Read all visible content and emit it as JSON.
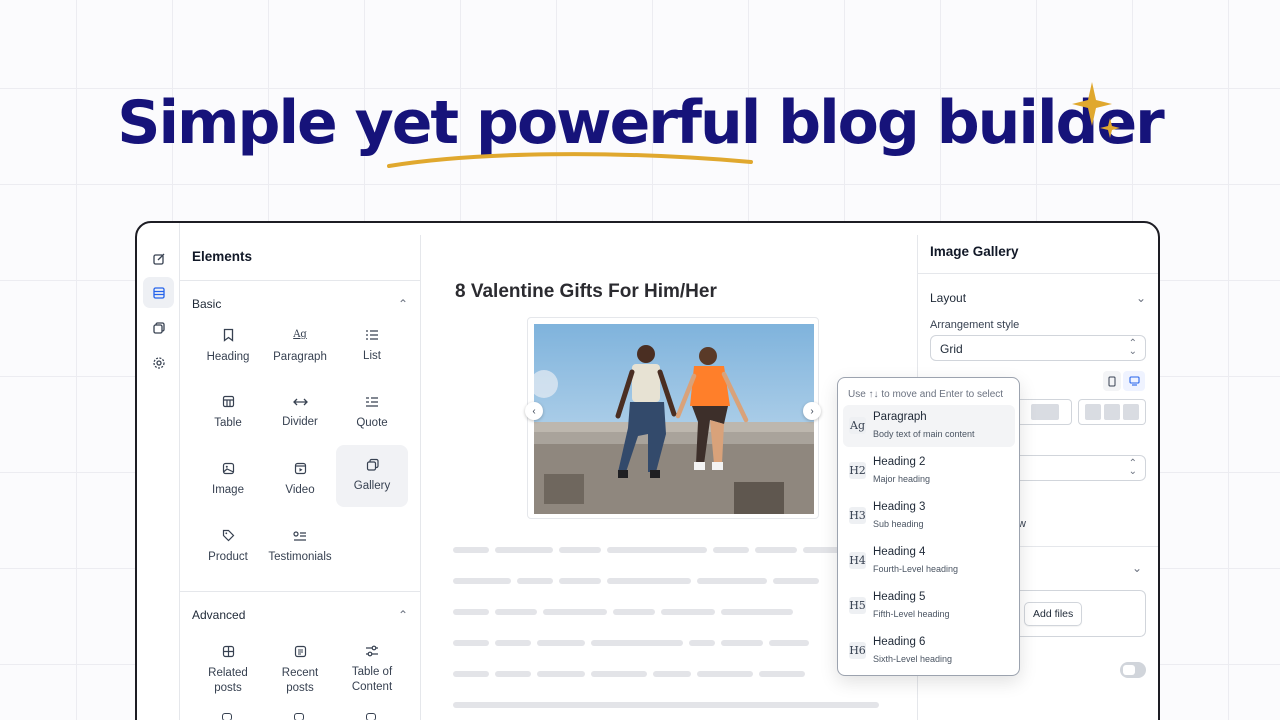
{
  "hero": {
    "title": "Simple yet powerful blog builder"
  },
  "sidebar": {
    "title": "Elements",
    "sections": [
      {
        "label": "Basic",
        "items": [
          "Heading",
          "Paragraph",
          "List",
          "Table",
          "Divider",
          "Quote",
          "Image",
          "Video",
          "Gallery",
          "Product",
          "Testimonials"
        ]
      },
      {
        "label": "Advanced",
        "items": [
          "Related posts",
          "Recent posts",
          "Table of Content"
        ]
      }
    ]
  },
  "canvas": {
    "post_title": "8 Valentine Gifts For Him/Her"
  },
  "panel": {
    "title": "Image Gallery",
    "layout_label": "Layout",
    "arrangement_label": "Arrangement style",
    "arrangement_value": "Grid",
    "partial_w": "w",
    "add_files": "Add files"
  },
  "popup": {
    "hint": "Use ↑↓ to move and Enter to select",
    "options": [
      {
        "icon": "Ag",
        "title": "Paragraph",
        "desc": "Body text of main content"
      },
      {
        "icon": "H2",
        "title": "Heading 2",
        "desc": "Major heading"
      },
      {
        "icon": "H3",
        "title": "Heading 3",
        "desc": "Sub heading"
      },
      {
        "icon": "H4",
        "title": "Heading 4",
        "desc": "Fourth-Level heading"
      },
      {
        "icon": "H5",
        "title": "Heading 5",
        "desc": "Fifth-Level heading"
      },
      {
        "icon": "H6",
        "title": "Heading 6",
        "desc": "Sixth-Level heading"
      }
    ]
  },
  "colors": {
    "brand_navy": "#16137a",
    "accent_gold": "#e0a82e",
    "frame": "#1d1d24",
    "active_blue": "#2563eb"
  }
}
